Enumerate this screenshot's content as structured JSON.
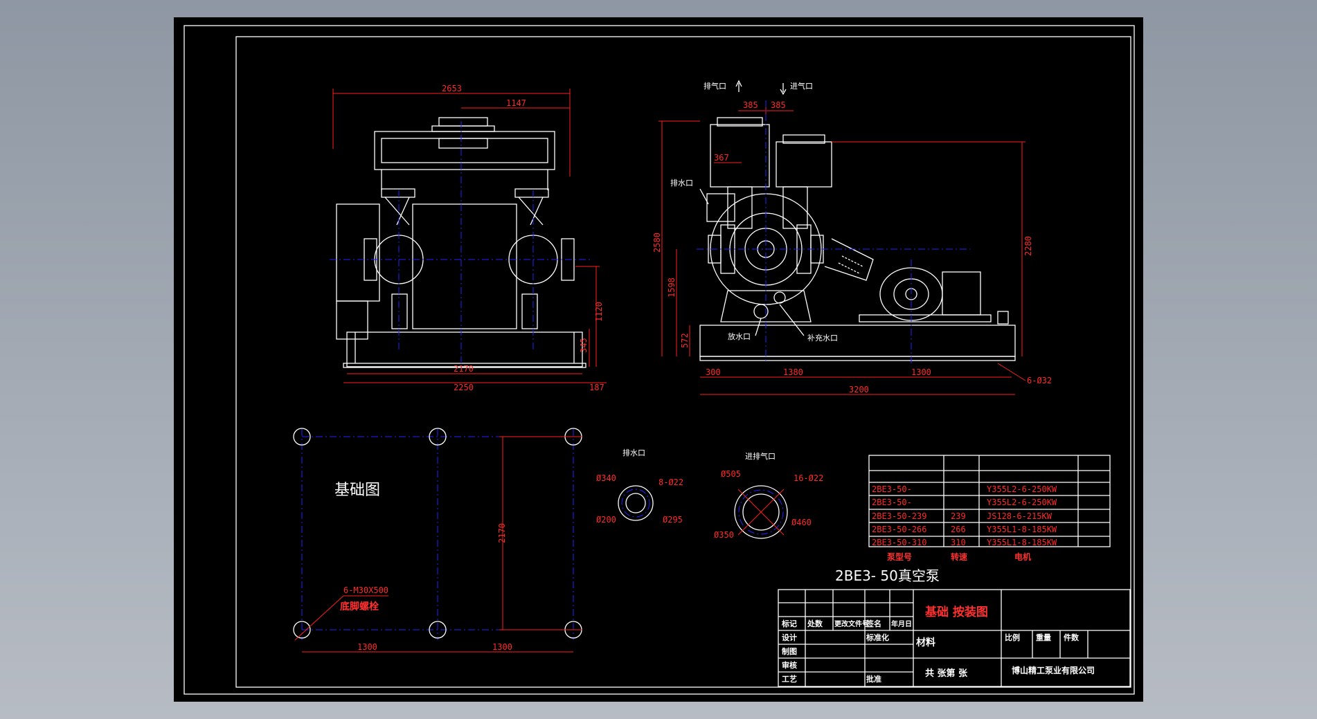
{
  "drawing": {
    "title": "2BE3- 50真空泵",
    "sheet_title": "基础 按装图",
    "company": "博山精工泵业有限公司",
    "foundation_label": "基础图",
    "bolt_spec": "6-M30X500",
    "bolt_label": "底脚螺栓",
    "material_label": "材料",
    "sheet_count": "共  张第  张"
  },
  "front_view": {
    "dims": [
      "2653",
      "1147",
      "2170",
      "2250",
      "187",
      "1120",
      "345"
    ]
  },
  "side_view": {
    "labels": {
      "exhaust": "排气口",
      "intake": "进气口",
      "drain_outlet": "排水口",
      "drain": "放水口",
      "supply_water": "补充水口"
    },
    "dims": [
      "385",
      "385",
      "367",
      "2580",
      "1598",
      "572",
      "2280",
      "300",
      "1380",
      "1300",
      "3200",
      "6-Ø32"
    ]
  },
  "foundation": {
    "dims": [
      "2170",
      "1300",
      "1300"
    ]
  },
  "flanges": {
    "drain": {
      "title": "排水口",
      "od": "Ø340",
      "holes": "8-Ø22",
      "id": "Ø200",
      "pcd": "Ø295"
    },
    "inout": {
      "title": "进排气口",
      "od": "Ø505",
      "holes": "16-Ø22",
      "id": "Ø350",
      "pcd": "Ø460"
    }
  },
  "parts_table": {
    "rows": [
      [
        "2BE3-50-",
        "",
        "Y355L2-6-250KW"
      ],
      [
        "2BE3-50-",
        "",
        "Y355L2-6-250KW"
      ],
      [
        "2BE3-50-239",
        "239",
        "JS128-6-215KW"
      ],
      [
        "2BE3-50-266",
        "266",
        "Y355L1-8-185KW"
      ],
      [
        "2BE3-50-310",
        "310",
        "Y355L1-8-185KW"
      ]
    ],
    "headers": [
      "泵型号",
      "转速",
      "电机"
    ]
  },
  "title_block": {
    "row1": [
      "标记",
      "处数",
      "更改文件号",
      "签名",
      "年月日"
    ],
    "left_rows": [
      "设计",
      "制图",
      "审核",
      "工艺"
    ],
    "std": "标准化",
    "approve": "批准",
    "right_hdr": [
      "比例",
      "重量",
      "件数"
    ]
  }
}
